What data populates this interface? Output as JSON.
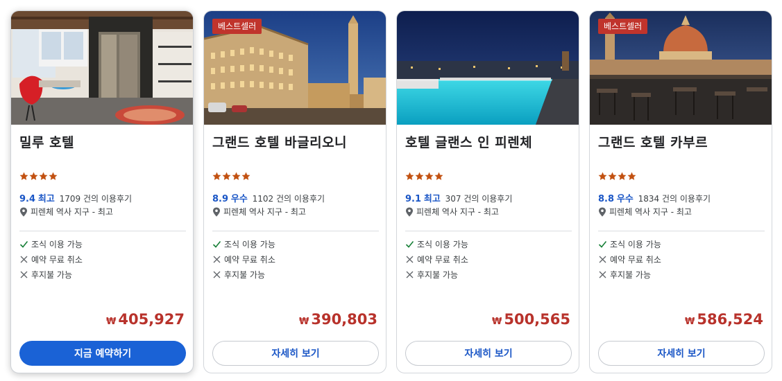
{
  "currency_symbol": "₩",
  "colors": {
    "accent": "#1a62d6",
    "price": "#b8322b",
    "badge": "#c0342c",
    "star": "#c25111",
    "check": "#188038"
  },
  "hotels": [
    {
      "name": "밀루 호텔",
      "badge": "",
      "stars": 4,
      "score": "9.4",
      "score_label": "최고",
      "reviews": "1709 건의 이용후기",
      "location": "피렌체 역사 지구 - 최고",
      "amenities": [
        {
          "label": "조식 이용 가능",
          "icon": "check-icon"
        },
        {
          "label": "예약 무료 취소",
          "icon": "x-icon"
        },
        {
          "label": "후지불 가능",
          "icon": "x-icon"
        }
      ],
      "price": "405,927",
      "button": "지금 예약하기"
    },
    {
      "name": "그랜드 호텔 바글리오니",
      "badge": "베스트셀러",
      "stars": 4,
      "score": "8.9",
      "score_label": "우수",
      "reviews": "1102 건의 이용후기",
      "location": "피렌체 역사 지구 - 최고",
      "amenities": [
        {
          "label": "조식 이용 가능",
          "icon": "check-icon"
        },
        {
          "label": "예약 무료 취소",
          "icon": "x-icon"
        },
        {
          "label": "후지불 가능",
          "icon": "x-icon"
        }
      ],
      "price": "390,803",
      "button": "자세히 보기"
    },
    {
      "name": "호텔 글랜스 인 피렌체",
      "badge": "",
      "stars": 4,
      "score": "9.1",
      "score_label": "최고",
      "reviews": "307 건의 이용후기",
      "location": "피렌체 역사 지구 - 최고",
      "amenities": [
        {
          "label": "조식 이용 가능",
          "icon": "check-icon"
        },
        {
          "label": "예약 무료 취소",
          "icon": "x-icon"
        },
        {
          "label": "후지불 가능",
          "icon": "x-icon"
        }
      ],
      "price": "500,565",
      "button": "자세히 보기"
    },
    {
      "name": "그랜드 호텔 카부르",
      "badge": "베스트셀러",
      "stars": 4,
      "score": "8.8",
      "score_label": "우수",
      "reviews": "1834 건의 이용후기",
      "location": "피렌체 역사 지구 - 최고",
      "amenities": [
        {
          "label": "조식 이용 가능",
          "icon": "check-icon"
        },
        {
          "label": "예약 무료 취소",
          "icon": "x-icon"
        },
        {
          "label": "후지불 가능",
          "icon": "x-icon"
        }
      ],
      "price": "586,524",
      "button": "자세히 보기"
    }
  ]
}
